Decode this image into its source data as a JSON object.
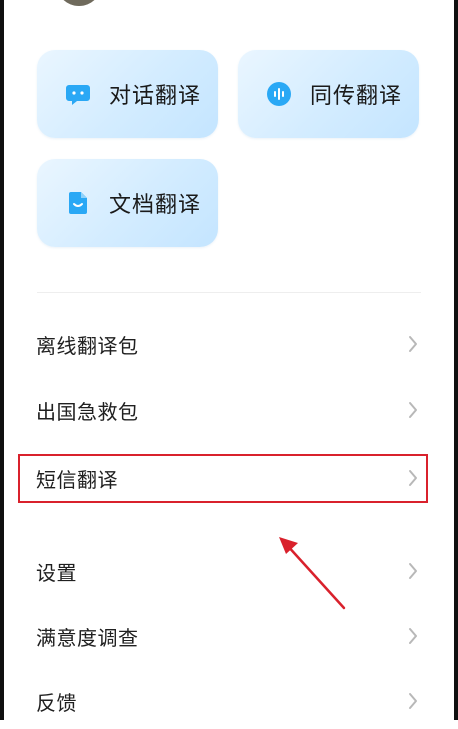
{
  "quick_actions": [
    {
      "label": "对话翻译",
      "icon": "chat-bubble-icon"
    },
    {
      "label": "同传翻译",
      "icon": "voice-wave-icon"
    },
    {
      "label": "文档翻译",
      "icon": "document-icon"
    }
  ],
  "menu": [
    {
      "label": "离线翻译包"
    },
    {
      "label": "出国急救包"
    },
    {
      "label": "短信翻译"
    },
    {
      "label": "设置"
    },
    {
      "label": "满意度调查"
    },
    {
      "label": "反馈"
    }
  ],
  "colors": {
    "card_gradient_start": "#eaf6ff",
    "card_gradient_end": "#c4e5ff",
    "icon_blue": "#2aa8f5",
    "highlight_red": "#d9212c",
    "chevron": "#b8b8b8"
  },
  "annotation": {
    "highlighted_item": "短信翻译",
    "arrow_icon": "red-arrow-icon"
  }
}
